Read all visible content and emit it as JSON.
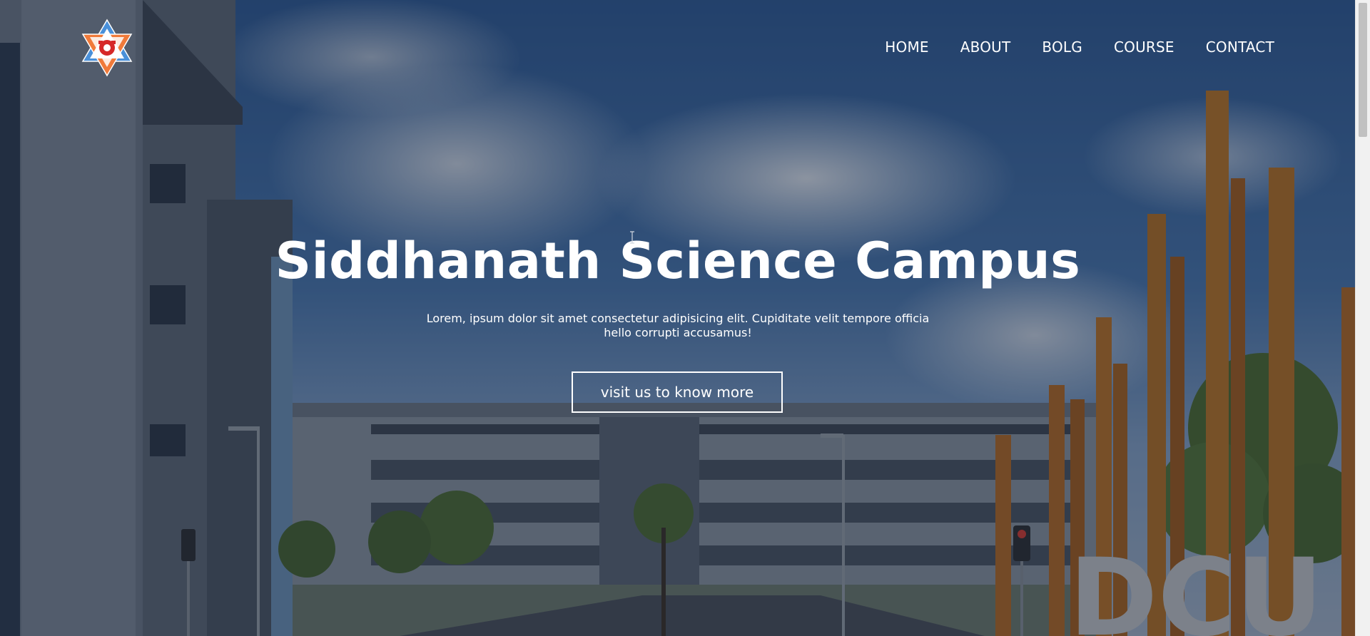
{
  "logo": {
    "alt": "Siddhanath Science Campus logo",
    "icon": "campus-star-logo-icon"
  },
  "nav": {
    "items": [
      {
        "label": "HOME"
      },
      {
        "label": "ABOUT"
      },
      {
        "label": "BOLG"
      },
      {
        "label": "COURSE"
      },
      {
        "label": "CONTACT"
      }
    ]
  },
  "hero": {
    "title": "Siddhanath Science Campus",
    "text": "Lorem, ipsum dolor sit amet consectetur adipisicing elit. Cupiditate velit tempore officia hello corrupti accusamus!",
    "button_label": "visit us to know more",
    "background_sign": "DCU"
  },
  "colors": {
    "overlay": "#142034",
    "text": "#ffffff",
    "logo_blue": "#4a90d9",
    "logo_orange": "#f07a3a",
    "logo_red": "#d62828"
  }
}
